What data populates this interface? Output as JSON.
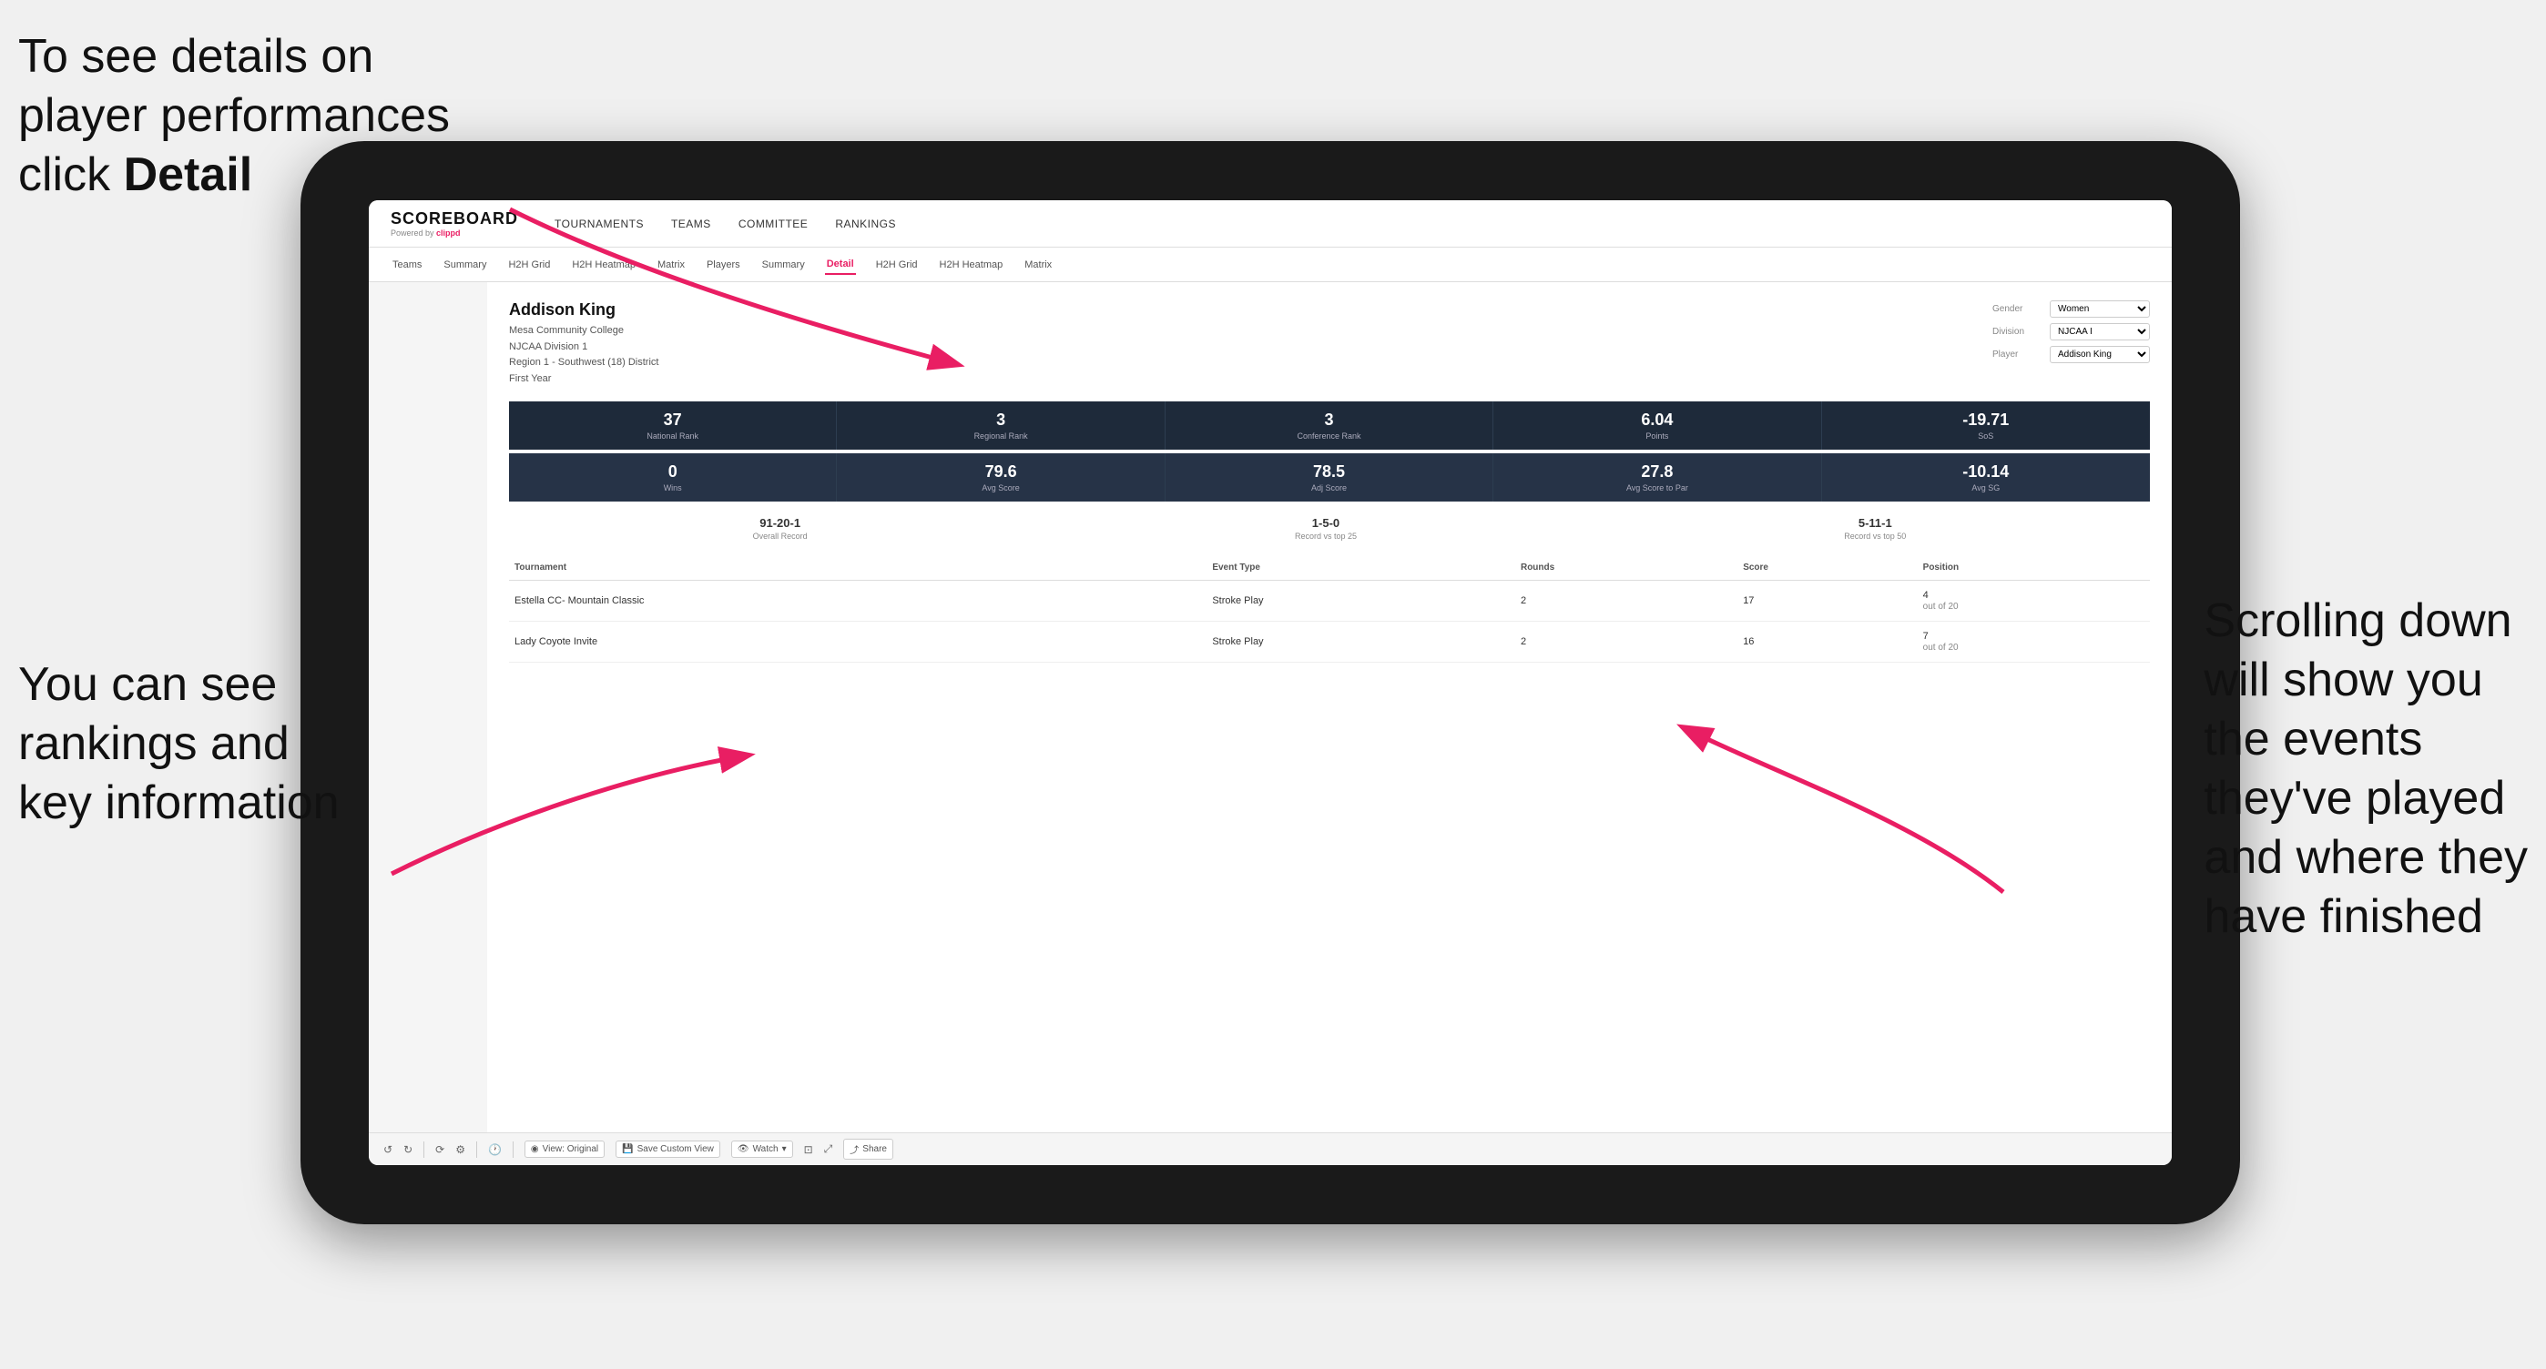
{
  "annotations": {
    "topleft": "To see details on\nplayer performances\nclick ",
    "topleft_bold": "Detail",
    "bottomleft_line1": "You can see",
    "bottomleft_line2": "rankings and",
    "bottomleft_line3": "key information",
    "bottomright_line1": "Scrolling down",
    "bottomright_line2": "will show you",
    "bottomright_line3": "the events",
    "bottomright_line4": "they've played",
    "bottomright_line5": "and where they",
    "bottomright_line6": "have finished"
  },
  "nav": {
    "logo": "SCOREBOARD",
    "logo_sub": "Powered by ",
    "logo_brand": "clippd",
    "items": [
      "TOURNAMENTS",
      "TEAMS",
      "COMMITTEE",
      "RANKINGS"
    ]
  },
  "subnav": {
    "items": [
      "Teams",
      "Summary",
      "H2H Grid",
      "H2H Heatmap",
      "Matrix",
      "Players",
      "Summary",
      "Detail",
      "H2H Grid",
      "H2H Heatmap",
      "Matrix"
    ],
    "active": "Detail"
  },
  "player": {
    "name": "Addison King",
    "school": "Mesa Community College",
    "division": "NJCAA Division 1",
    "region": "Region 1 - Southwest (18) District",
    "year": "First Year"
  },
  "filters": {
    "gender_label": "Gender",
    "gender_value": "Women",
    "division_label": "Division",
    "division_value": "NJCAA I",
    "player_label": "Player",
    "player_value": "Addison King"
  },
  "stats_row1": [
    {
      "value": "37",
      "label": "National Rank"
    },
    {
      "value": "3",
      "label": "Regional Rank"
    },
    {
      "value": "3",
      "label": "Conference Rank"
    },
    {
      "value": "6.04",
      "label": "Points"
    },
    {
      "value": "-19.71",
      "label": "SoS"
    }
  ],
  "stats_row2": [
    {
      "value": "0",
      "label": "Wins"
    },
    {
      "value": "79.6",
      "label": "Avg Score"
    },
    {
      "value": "78.5",
      "label": "Adj Score"
    },
    {
      "value": "27.8",
      "label": "Avg Score to Par"
    },
    {
      "value": "-10.14",
      "label": "Avg SG"
    }
  ],
  "records": [
    {
      "value": "91-20-1",
      "label": "Overall Record"
    },
    {
      "value": "1-5-0",
      "label": "Record vs top 25"
    },
    {
      "value": "5-11-1",
      "label": "Record vs top 50"
    }
  ],
  "table": {
    "headers": [
      "Tournament",
      "Event Type",
      "Rounds",
      "Score",
      "Position"
    ],
    "rows": [
      {
        "tournament": "Estella CC- Mountain Classic",
        "event_type": "Stroke Play",
        "rounds": "2",
        "score": "17",
        "position": "4\nout of 20"
      },
      {
        "tournament": "Lady Coyote Invite",
        "event_type": "Stroke Play",
        "rounds": "2",
        "score": "16",
        "position": "7\nout of 20"
      }
    ]
  },
  "toolbar": {
    "view_label": "View: Original",
    "save_label": "Save Custom View",
    "watch_label": "Watch",
    "share_label": "Share"
  }
}
